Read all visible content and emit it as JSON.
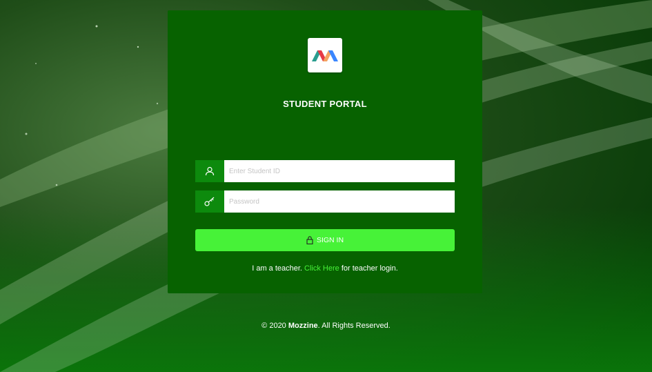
{
  "portal": {
    "title": "STUDENT PORTAL",
    "logo_icon": "mozzine-m-logo"
  },
  "form": {
    "student_id": {
      "placeholder": "Enter Student ID",
      "value": "",
      "icon": "user-icon"
    },
    "password": {
      "placeholder": "Password",
      "value": "",
      "icon": "key-icon"
    },
    "signin_label": "SIGN IN",
    "signin_icon": "lock-icon"
  },
  "teacher_prompt": {
    "prefix": "I am a teacher.",
    "link_text": "Click Here",
    "suffix": "for teacher login."
  },
  "footer": {
    "prefix": "© 2020",
    "brand": "Mozzine",
    "suffix": ". All Rights Reserved."
  },
  "colors": {
    "card": "#076200",
    "addon": "#0d8a0d",
    "accent": "#47f238"
  }
}
